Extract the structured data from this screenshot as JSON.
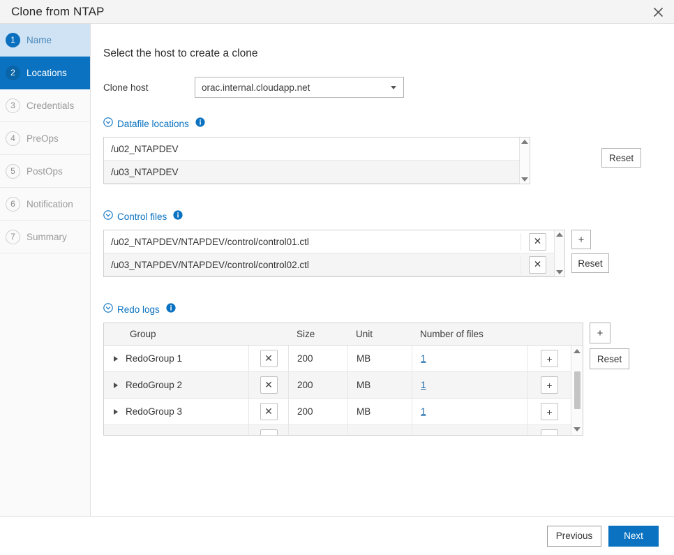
{
  "window": {
    "title": "Clone from NTAP",
    "close_icon": "close-icon"
  },
  "sidebar": {
    "items": [
      {
        "num": "1",
        "label": "Name",
        "state": "done"
      },
      {
        "num": "2",
        "label": "Locations",
        "state": "active"
      },
      {
        "num": "3",
        "label": "Credentials",
        "state": "pending"
      },
      {
        "num": "4",
        "label": "PreOps",
        "state": "pending"
      },
      {
        "num": "5",
        "label": "PostOps",
        "state": "pending"
      },
      {
        "num": "6",
        "label": "Notification",
        "state": "pending"
      },
      {
        "num": "7",
        "label": "Summary",
        "state": "pending"
      }
    ]
  },
  "main": {
    "heading": "Select the host to create a clone",
    "clone_host": {
      "label": "Clone host",
      "value": "orac.internal.cloudapp.net",
      "caret_icon": "chevron-down-icon"
    },
    "datafile_locations": {
      "title": "Datafile locations",
      "collapse_icon": "circle-chevron-down-icon",
      "info_icon": "info-icon",
      "rows": [
        "/u02_NTAPDEV",
        "/u03_NTAPDEV"
      ],
      "reset_label": "Reset"
    },
    "control_files": {
      "title": "Control files",
      "collapse_icon": "circle-chevron-down-icon",
      "info_icon": "info-icon",
      "rows": [
        "/u02_NTAPDEV/NTAPDEV/control/control01.ctl",
        "/u03_NTAPDEV/NTAPDEV/control/control02.ctl"
      ],
      "remove_label": "✕",
      "add_label": "+",
      "reset_label": "Reset"
    },
    "redo_logs": {
      "title": "Redo logs",
      "collapse_icon": "circle-chevron-down-icon",
      "info_icon": "info-icon",
      "columns": [
        "Group",
        "Size",
        "Unit",
        "Number of files"
      ],
      "rows": [
        {
          "group": "RedoGroup 1",
          "size": "200",
          "unit": "MB",
          "files": "1"
        },
        {
          "group": "RedoGroup 2",
          "size": "200",
          "unit": "MB",
          "files": "1"
        },
        {
          "group": "RedoGroup 3",
          "size": "200",
          "unit": "MB",
          "files": "1"
        }
      ],
      "remove_label": "✕",
      "row_add_label": "+",
      "add_label": "+",
      "reset_label": "Reset"
    }
  },
  "footer": {
    "previous_label": "Previous",
    "next_label": "Next"
  },
  "colors": {
    "accent": "#0a72c0",
    "active_step_bg": "#0a72c0",
    "done_step_bg": "#cfe3f4",
    "link": "#1464a5"
  }
}
